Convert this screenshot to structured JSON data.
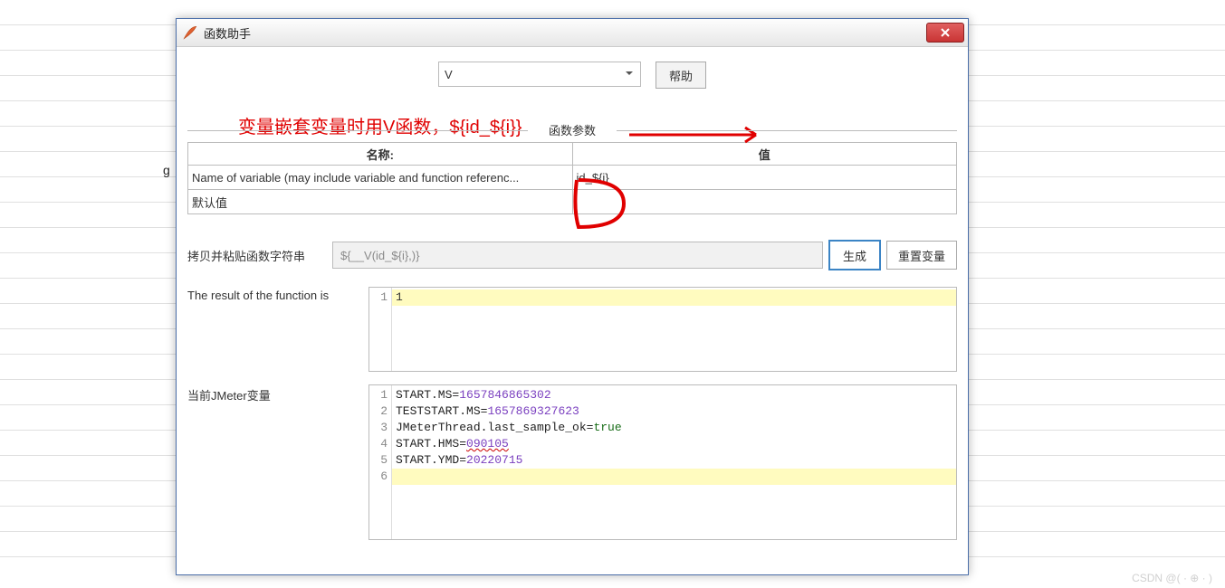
{
  "window": {
    "title": "函数助手"
  },
  "selector": {
    "value": "V"
  },
  "buttons": {
    "help": "帮助",
    "generate": "生成",
    "reset_vars": "重置变量"
  },
  "annotation": {
    "text": "变量嵌套变量时用V函数，${id_${i}}"
  },
  "params": {
    "group_label": "函数参数",
    "header_name": "名称:",
    "header_value": "值",
    "rows": [
      {
        "name": "Name of variable (may include variable and function referenc...",
        "value": "id_${i}"
      },
      {
        "name": "默认值",
        "value": ""
      }
    ]
  },
  "copy_row": {
    "label": "拷贝并粘贴函数字符串",
    "value": "${__V(id_${i},)}"
  },
  "result": {
    "label": "The result of the function is",
    "lines": [
      "1"
    ]
  },
  "jmeter_vars": {
    "label": "当前JMeter变量",
    "lines": [
      {
        "key": "START.MS",
        "val": "1657846865302",
        "valClass": "k-num"
      },
      {
        "key": "TESTSTART.MS",
        "val": "1657869327623",
        "valClass": "k-num"
      },
      {
        "key": "JMeterThread.last_sample_ok",
        "val": "true",
        "valClass": "k-true"
      },
      {
        "key": "START.HMS",
        "val": "090105",
        "valClass": "k-num k-underline"
      },
      {
        "key": "START.YMD",
        "val": "20220715",
        "valClass": "k-num"
      }
    ]
  },
  "watermark": "CSDN @( · ⊕ · )"
}
